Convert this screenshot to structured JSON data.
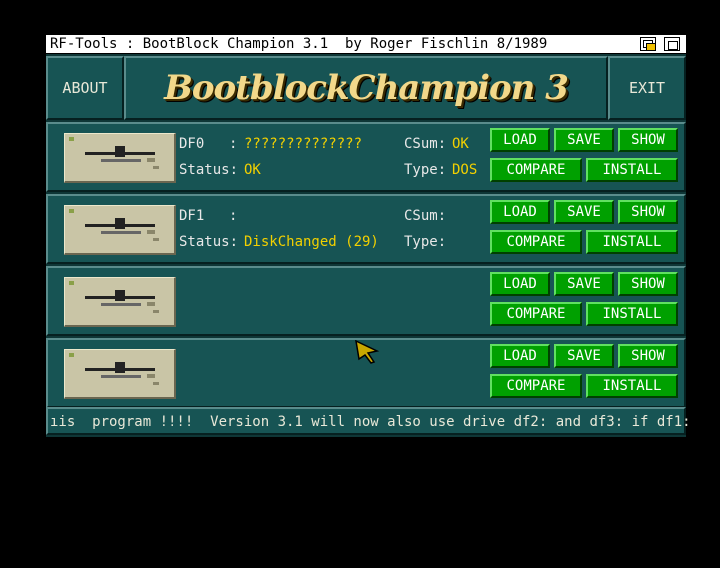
{
  "window": {
    "title": "RF-Tools : BootBlock Champion 3.1  by Roger Fischlin 8/1989"
  },
  "header": {
    "about_label": "ABOUT",
    "logo_text": "BootblockChampion 3",
    "exit_label": "EXIT"
  },
  "drives": [
    {
      "name": "DF0",
      "colon": ":",
      "bootblock": "??????????????",
      "status_label": "Status:",
      "status": "OK",
      "csum_label": "CSum:",
      "csum": "OK",
      "type_label": "Type:",
      "type": "DOS"
    },
    {
      "name": "DF1",
      "colon": ":",
      "bootblock": "",
      "status_label": "Status:",
      "status": "DiskChanged (29)",
      "csum_label": "CSum:",
      "csum": "",
      "type_label": "Type:",
      "type": ""
    }
  ],
  "buttons": {
    "load": "LOAD",
    "save": "SAVE",
    "show": "SHOW",
    "compare": "COMPARE",
    "install": "INSTALL"
  },
  "scroller": {
    "text": "ıis  program !!!!  Version 3.1 will now also use drive df2: and df3: if df1:"
  },
  "colors": {
    "background": "#0e3636",
    "panel": "#175454",
    "button": "#00a000",
    "value_text": "#f2d000",
    "logo": "#f2d88a"
  },
  "icons": {
    "drive": "floppy-drive-icon",
    "pointer": "mouse-pointer-icon"
  }
}
